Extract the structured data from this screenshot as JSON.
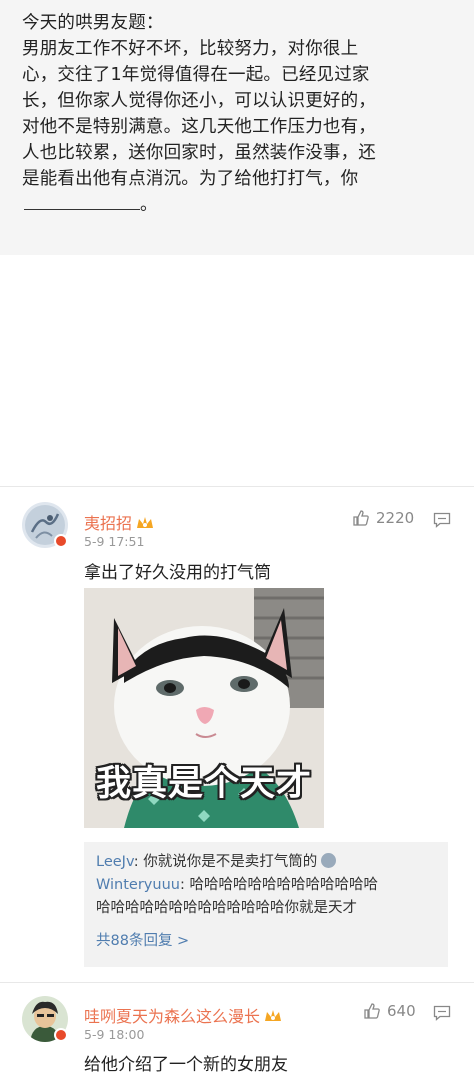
{
  "question": {
    "lines": [
      "今天的哄男友题：",
      "男朋友工作不好不坏，比较努力，对你很上",
      "心，交往了1年觉得值得在一起。已经见过家",
      "长，但你家人觉得你还小，可以认识更好的，",
      "对他不是特别满意。这几天他工作压力也有，",
      "人也比较累，送你回家时，虽然装作没事，还",
      "是能看出他有点消沉。为了给他打打气，你"
    ],
    "ending": "。"
  },
  "comments": [
    {
      "username": "夷招招",
      "time": "5-9 17:51",
      "likes": "2220",
      "text": "拿出了好久没用的打气筒",
      "meme_caption": "我真是个天才",
      "replies": [
        {
          "name": "LeeJv",
          "text": "你就说你是不是卖打气筒的"
        },
        {
          "name": "Winteryuuu",
          "text": "哈哈哈哈哈哈哈哈哈哈哈哈哈"
        },
        {
          "name": "",
          "text": "哈哈哈哈哈哈哈哈哈哈哈哈哈你就是天才"
        }
      ],
      "more_replies": "共88条回复 >"
    },
    {
      "username": "哇咧夏天为森么这么漫长",
      "time": "5-9 18:00",
      "likes": "640",
      "text": "给他介绍了一个新的女朋友"
    }
  ],
  "colors": {
    "username": "#eb7350",
    "reply_name": "#507daf",
    "badge": "#e84a2a"
  }
}
